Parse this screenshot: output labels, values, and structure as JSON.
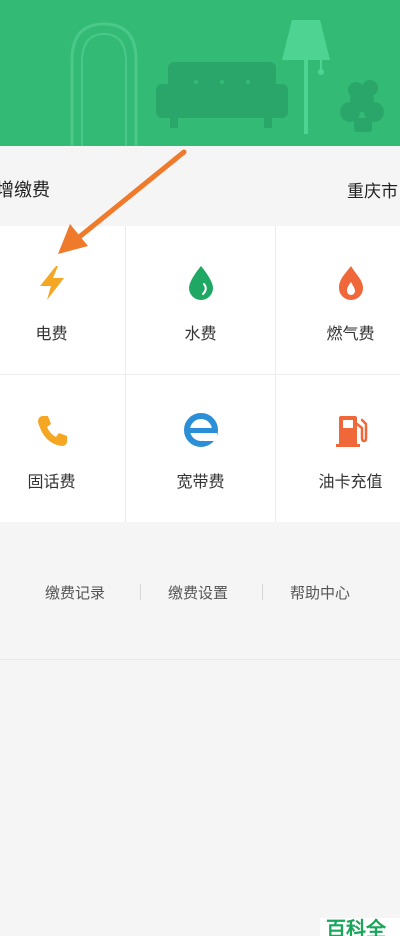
{
  "header": {
    "title": "增缴费",
    "city": "重庆市"
  },
  "services": [
    {
      "label": "电费",
      "icon": "lightning-icon",
      "color": "#f5a623"
    },
    {
      "label": "水费",
      "icon": "water-drop-icon",
      "color": "#1fa864"
    },
    {
      "label": "燃气费",
      "icon": "flame-icon",
      "color": "#f0673a"
    },
    {
      "label": "固话费",
      "icon": "phone-icon",
      "color": "#f5a623"
    },
    {
      "label": "宽带费",
      "icon": "broadband-icon",
      "color": "#2a8fd6"
    },
    {
      "label": "油卡充值",
      "icon": "fuel-pump-icon",
      "color": "#f0673a"
    }
  ],
  "links": [
    "缴费记录",
    "缴费设置",
    "帮助中心"
  ],
  "watermark": "百科全",
  "colors": {
    "banner": "#33bb76",
    "arrow": "#f07a2c"
  }
}
